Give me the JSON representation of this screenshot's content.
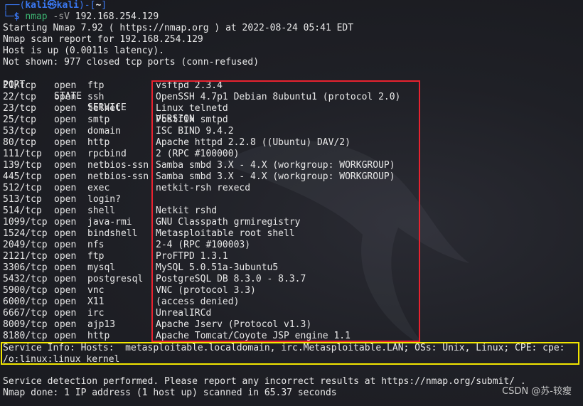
{
  "prompt": {
    "corner_top": "┌──(",
    "user": "kali",
    "at": "㉿",
    "host": "kali",
    "mid": ")-[",
    "path": "~",
    "end": "]",
    "corner_bottom": "└─",
    "dollar": "$",
    "command": "nmap",
    "flag": "-sV",
    "target": "192.168.254.129"
  },
  "output_header": [
    "Starting Nmap 7.92 ( https://nmap.org ) at 2022-08-24 05:41 EDT",
    "Nmap scan report for 192.168.254.129",
    "Host is up (0.0011s latency).",
    "Not shown: 977 closed tcp ports (conn-refused)"
  ],
  "table_header": {
    "port": "PORT",
    "state": "STATE",
    "service": "SERVICE",
    "version": "VERSION"
  },
  "rows": [
    {
      "port": "21/tcp",
      "state": "open",
      "service": "ftp",
      "version": "vsftpd 2.3.4"
    },
    {
      "port": "22/tcp",
      "state": "open",
      "service": "ssh",
      "version": "OpenSSH 4.7p1 Debian 8ubuntu1 (protocol 2.0)"
    },
    {
      "port": "23/tcp",
      "state": "open",
      "service": "telnet",
      "version": "Linux telnetd"
    },
    {
      "port": "25/tcp",
      "state": "open",
      "service": "smtp",
      "version": "Postfix smtpd"
    },
    {
      "port": "53/tcp",
      "state": "open",
      "service": "domain",
      "version": "ISC BIND 9.4.2"
    },
    {
      "port": "80/tcp",
      "state": "open",
      "service": "http",
      "version": "Apache httpd 2.2.8 ((Ubuntu) DAV/2)"
    },
    {
      "port": "111/tcp",
      "state": "open",
      "service": "rpcbind",
      "version": "2 (RPC #100000)"
    },
    {
      "port": "139/tcp",
      "state": "open",
      "service": "netbios-ssn",
      "version": "Samba smbd 3.X - 4.X (workgroup: WORKGROUP)"
    },
    {
      "port": "445/tcp",
      "state": "open",
      "service": "netbios-ssn",
      "version": "Samba smbd 3.X - 4.X (workgroup: WORKGROUP)"
    },
    {
      "port": "512/tcp",
      "state": "open",
      "service": "exec",
      "version": "netkit-rsh rexecd"
    },
    {
      "port": "513/tcp",
      "state": "open",
      "service": "login?",
      "version": ""
    },
    {
      "port": "514/tcp",
      "state": "open",
      "service": "shell",
      "version": "Netkit rshd"
    },
    {
      "port": "1099/tcp",
      "state": "open",
      "service": "java-rmi",
      "version": "GNU Classpath grmiregistry"
    },
    {
      "port": "1524/tcp",
      "state": "open",
      "service": "bindshell",
      "version": "Metasploitable root shell"
    },
    {
      "port": "2049/tcp",
      "state": "open",
      "service": "nfs",
      "version": "2-4 (RPC #100003)"
    },
    {
      "port": "2121/tcp",
      "state": "open",
      "service": "ftp",
      "version": "ProFTPD 1.3.1"
    },
    {
      "port": "3306/tcp",
      "state": "open",
      "service": "mysql",
      "version": "MySQL 5.0.51a-3ubuntu5"
    },
    {
      "port": "5432/tcp",
      "state": "open",
      "service": "postgresql",
      "version": "PostgreSQL DB 8.3.0 - 8.3.7"
    },
    {
      "port": "5900/tcp",
      "state": "open",
      "service": "vnc",
      "version": "VNC (protocol 3.3)"
    },
    {
      "port": "6000/tcp",
      "state": "open",
      "service": "X11",
      "version": "(access denied)"
    },
    {
      "port": "6667/tcp",
      "state": "open",
      "service": "irc",
      "version": "UnrealIRCd"
    },
    {
      "port": "8009/tcp",
      "state": "open",
      "service": "ajp13",
      "version": "Apache Jserv (Protocol v1.3)"
    },
    {
      "port": "8180/tcp",
      "state": "open",
      "service": "http",
      "version": "Apache Tomcat/Coyote JSP engine 1.1"
    }
  ],
  "service_info": [
    "Service Info: Hosts:  metasploitable.localdomain, irc.Metasploitable.LAN; OSs: Unix, Linux; CPE: cpe:",
    "/o:linux:linux_kernel"
  ],
  "footer": [
    "Service detection performed. Please report any incorrect results at https://nmap.org/submit/ .",
    "Nmap done: 1 IP address (1 host up) scanned in 65.37 seconds"
  ],
  "watermark": "CSDN @苏-较瘦",
  "colors": {
    "prompt_blue": "#3a78f2",
    "command_green": "#3cb371",
    "highlight_red": "#e8222f",
    "highlight_yellow": "#f2e600"
  }
}
